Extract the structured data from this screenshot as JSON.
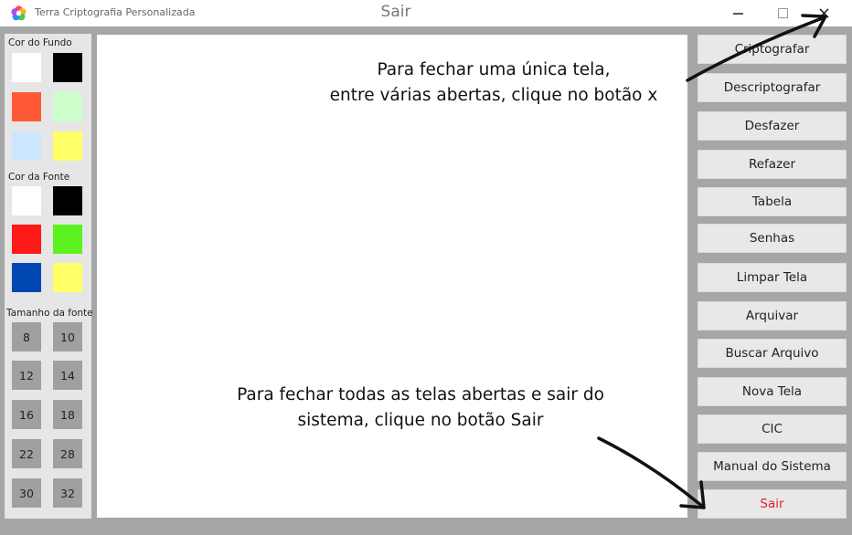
{
  "titlebar": {
    "app_name": "Terra Criptografia Personalizada",
    "window_title": "Sair",
    "icons": [
      "app-logo-icon",
      "minimize-icon",
      "maximize-icon",
      "close-icon"
    ]
  },
  "left_panel": {
    "background_label": "Cor do Fundo",
    "background_colors": [
      "#ffffff",
      "#000000",
      "#ff5a36",
      "#ccffcc",
      "#cce6ff",
      "#ffff66"
    ],
    "font_color_label": "Cor da Fonte",
    "font_colors": [
      "#ffffff",
      "#000000",
      "#ff1a1a",
      "#5cf21f",
      "#0047b3",
      "#ffff66"
    ],
    "font_size_label": "Tamanho da fonte",
    "font_sizes": [
      "8",
      "10",
      "12",
      "14",
      "16",
      "18",
      "22",
      "28",
      "30",
      "32"
    ]
  },
  "menu": {
    "buttons": [
      "Criptografar",
      "Descriptografar",
      "Desfazer",
      "Refazer",
      "Tabela",
      "Senhas",
      "Limpar Tela",
      "Arquivar",
      "Buscar Arquivo",
      "Nova Tela",
      "CIC",
      "Manual do Sistema"
    ],
    "exit_label": "Sair",
    "exit_color": "#e0202a"
  },
  "annotations": {
    "top": {
      "line1": "Para fechar uma única tela,",
      "line2": "entre várias abertas, clique no botão x"
    },
    "bottom": {
      "line1": "Para fechar todas as telas abertas e sair do",
      "line2": "sistema, clique no botão Sair"
    }
  }
}
